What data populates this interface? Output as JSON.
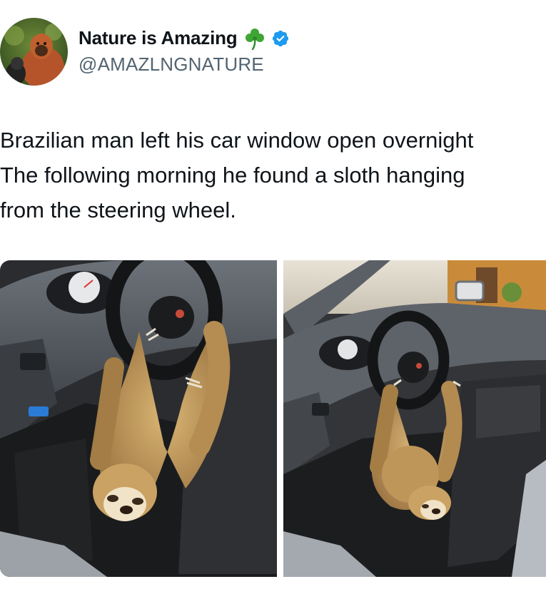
{
  "tweet": {
    "author": {
      "display_name": "Nature is Amazing",
      "handle": "@AMAZLNGNATURE",
      "avatar": "orangutan-avatar",
      "emoji": "shamrock-icon",
      "verified": "verified-badge-icon",
      "verified_color": "#1d9bf0"
    },
    "text_lines": [
      "Brazilian man left his car window open overnight",
      "The following morning he found a sloth hanging",
      "from the steering wheel."
    ],
    "media": [
      {
        "description": "sloth-hanging-from-steering-wheel-closeup"
      },
      {
        "description": "sloth-hanging-from-steering-wheel-wide"
      }
    ]
  }
}
